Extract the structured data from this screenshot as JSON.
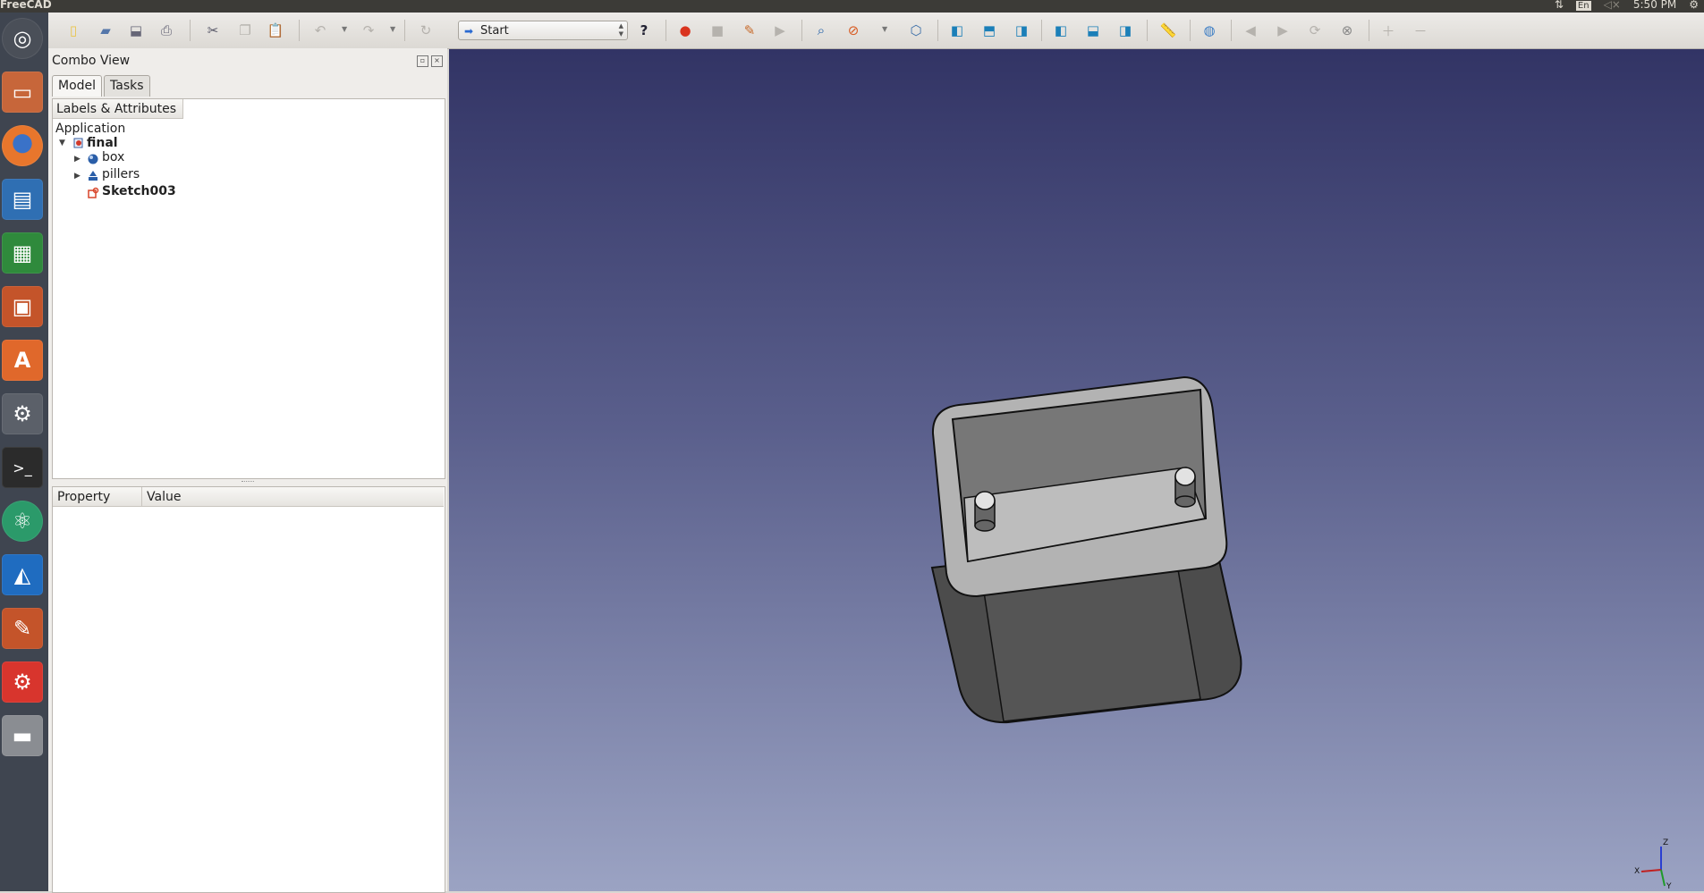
{
  "system_bar": {
    "app_title": "FreeCAD",
    "keyboard_layout": "En",
    "clock": "5:50 PM",
    "icons": [
      "network-icon",
      "keyboard-icon",
      "volume-icon",
      "settings-gear-icon"
    ]
  },
  "launcher": {
    "items": [
      {
        "name": "dash-home",
        "icon": "ubuntu-logo-icon",
        "color": "#4a4f58"
      },
      {
        "name": "files",
        "icon": "file-cabinet-icon",
        "color": "#c7663a"
      },
      {
        "name": "firefox",
        "icon": "firefox-icon",
        "color": "#e8762c"
      },
      {
        "name": "writer",
        "icon": "document-icon",
        "color": "#2f6fb3"
      },
      {
        "name": "calc",
        "icon": "spreadsheet-icon",
        "color": "#2f8a3c"
      },
      {
        "name": "impress",
        "icon": "presentation-icon",
        "color": "#c4542a"
      },
      {
        "name": "software-center",
        "icon": "shopping-bag-icon",
        "color": "#e0682b"
      },
      {
        "name": "system-settings",
        "icon": "wrench-icon",
        "color": "#5b6069"
      },
      {
        "name": "terminal",
        "icon": "terminal-icon",
        "color": "#2b2b2b"
      },
      {
        "name": "atom",
        "icon": "atom-icon",
        "color": "#2b9a6a"
      },
      {
        "name": "app-blue",
        "icon": "blue-app-icon",
        "color": "#1f6cc0"
      },
      {
        "name": "text-editor",
        "icon": "pencil-icon",
        "color": "#c4542a"
      },
      {
        "name": "freecad",
        "icon": "freecad-gear-icon",
        "color": "#d8352d"
      },
      {
        "name": "drive",
        "icon": "hard-drive-icon",
        "color": "#8a8d92"
      }
    ]
  },
  "toolbar": {
    "workbench": "Start",
    "buttons": [
      "new-file",
      "open-file",
      "save",
      "print",
      "cut",
      "copy",
      "paste",
      "undo",
      "redo",
      "refresh",
      "workbench-select",
      "whats-this",
      "record-macro",
      "stop-macro",
      "edit-macro",
      "run-macro",
      "fit-all",
      "draw-style",
      "isometric",
      "front-view",
      "top-view",
      "right-view",
      "rear-view",
      "bottom-view",
      "left-view",
      "measure",
      "web-home",
      "back",
      "forward",
      "refresh-web",
      "stop-web",
      "zoom-in",
      "zoom-out"
    ]
  },
  "combo_view": {
    "title": "Combo View",
    "tabs": [
      {
        "label": "Model",
        "active": true
      },
      {
        "label": "Tasks",
        "active": false
      }
    ],
    "tree_header": "Labels & Attributes",
    "tree": {
      "root_label": "Application",
      "document": "final",
      "children": [
        {
          "label": "box",
          "icon": "part-feature-icon",
          "expandable": true
        },
        {
          "label": "pillers",
          "icon": "part-extrude-icon",
          "expandable": true
        },
        {
          "label": "Sketch003",
          "icon": "sketch-icon",
          "expandable": false
        }
      ]
    },
    "property_headers": {
      "property": "Property",
      "value": "Value"
    }
  },
  "viewport": {
    "background_top": "#323465",
    "background_bottom": "#9ba3c3",
    "axis_labels": {
      "z": "Z",
      "y": "Y",
      "x": "X"
    }
  }
}
